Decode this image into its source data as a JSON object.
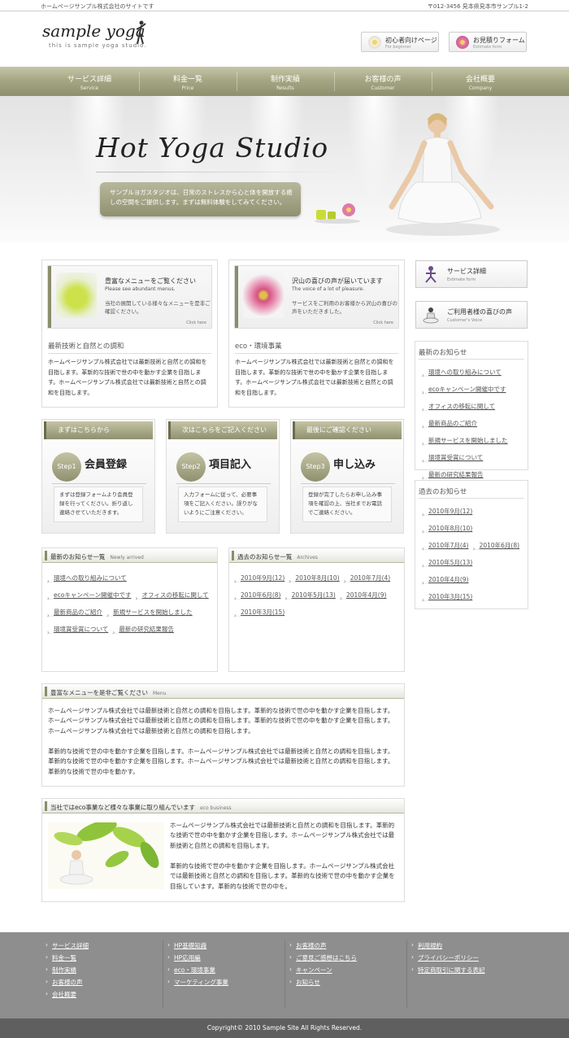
{
  "topbar": {
    "left": "ホームページサンプル株式会社のサイトです",
    "right": "〒012-3456 見本県見本市サンプル1-2"
  },
  "logo": {
    "title": "sample yoga",
    "subtitle": "this is sample yoga studio."
  },
  "header_buttons": [
    {
      "label": "初心者向けページ",
      "sub": "For beginner",
      "icon": "daisy-icon",
      "color": "#e9e4d0"
    },
    {
      "label": "お見積りフォーム",
      "sub": "Estimate form",
      "icon": "flower-icon",
      "color": "#d97aa0"
    }
  ],
  "nav": [
    {
      "label": "サービス詳細",
      "sub": "Service"
    },
    {
      "label": "料金一覧",
      "sub": "Price"
    },
    {
      "label": "制作実績",
      "sub": "Results"
    },
    {
      "label": "お客様の声",
      "sub": "Customer"
    },
    {
      "label": "会社概要",
      "sub": "Company"
    }
  ],
  "hero": {
    "title": "Hot Yoga Studio",
    "text": "サンプルヨガスタジオは、日常のストレスから心と体を開放する癒しの空間をご提供します。まずは無料体験をしてみてください。"
  },
  "features": [
    {
      "title": "豊富なメニューをご覧ください",
      "sub": "Please see abundant menus.",
      "text": "当社の展開している様々なメニューを是非ご確認ください。",
      "more": "Click here",
      "heading": "最新技術と自然との調和",
      "body": "ホームページサンプル株式会社では最新技術と自然との調和を目指します。革新的な技術で世の中を動かす企業を目指します。ホームページサンプル株式会社では最新技術と自然との調和を目指します。"
    },
    {
      "title": "沢山の喜びの声が届いています",
      "sub": "The voice of a lot of pleasure.",
      "text": "サービスをご利用のお客様から沢山の喜びの声をいただきました。",
      "more": "Click here",
      "heading": "eco・環境事業",
      "body": "ホームページサンプル株式会社では最新技術と自然との調和を目指します。革新的な技術で世の中を動かす企業を目指します。ホームページサンプル株式会社では最新技術と自然との調和を目指します。"
    }
  ],
  "steps": [
    {
      "head": "まずはこちらから",
      "step": "Step1",
      "title": "会員登録",
      "desc": "まずは登録フォームより会員登録を行ってください。折り返し連絡させていただきます。"
    },
    {
      "head": "次はこちらをご記入ください",
      "step": "Step2",
      "title": "項目記入",
      "desc": "入力フォームに従って、必要事項をご記入ください。誤りがないようにご注意ください。"
    },
    {
      "head": "最後にご確認ください",
      "step": "Step3",
      "title": "申し込み",
      "desc": "登録が完了したらお申し込み事項を確認の上、当社までお電話でご連絡ください。"
    }
  ],
  "news": {
    "title": "最新のお知らせ一覧",
    "sub": "Newly arrived",
    "items": [
      "環境への取り組みについて",
      "ecoキャンペーン開催中です",
      "オフィスの移転に関して",
      "最新商品のご紹介",
      "新規サービスを開始しました",
      "環境賞受賞について",
      "最新の研究結果報告"
    ]
  },
  "archives": {
    "title": "過去のお知らせ一覧",
    "sub": "Archives",
    "items": [
      "2010年9月(12)",
      "2010年8月(10)",
      "2010年7月(4)",
      "2010年6月(8)",
      "2010年5月(13)",
      "2010年4月(9)",
      "2010年3月(15)"
    ]
  },
  "menu_section": {
    "title": "豊富なメニューを是非ご覧ください",
    "sub": "Menu",
    "p1": "ホームページサンプル株式会社では最新技術と自然との調和を目指します。革新的な技術で世の中を動かす企業を目指します。ホームページサンプル株式会社では最新技術と自然との調和を目指します。革新的な技術で世の中を動かす企業を目指します。ホームページサンプル株式会社では最新技術と自然との調和を目指します。",
    "p2": "革新的な技術で世の中を動かす企業を目指します。ホームページサンプル株式会社では最新技術と自然との調和を目指します。革新的な技術で世の中を動かす企業を目指します。ホームページサンプル株式会社では最新技術と自然との調和を目指します。革新的な技術で世の中を動かす。"
  },
  "eco_section": {
    "title": "当社ではeco事業など様々な事業に取り組んでいます",
    "sub": "eco business",
    "p1": "ホームページサンプル株式会社では最新技術と自然との調和を目指します。革新的な技術で世の中を動かす企業を目指します。ホームページサンプル株式会社では最新技術と自然との調和を目指します。",
    "p2": "革新的な技術で世の中を動かす企業を目指します。ホームページサンプル株式会社では最新技術と自然との調和を目指します。革新的な技術で世の中を動かす企業を目指しています。革新的な技術で世の中を。"
  },
  "sidebar": {
    "buttons": [
      {
        "label": "サービス詳細",
        "sub": "Estimate form"
      },
      {
        "label": "ご利用者様の喜びの声",
        "sub": "Customer's Voice"
      }
    ],
    "news_title": "最新のお知らせ",
    "news": [
      "環境への取り組みについて",
      "ecoキャンペーン開催中です",
      "オフィスの移転に関して",
      "最新商品のご紹介",
      "新規サービスを開始しました",
      "環境賞受賞について",
      "最新の研究結果報告"
    ],
    "archive_title": "過去のお知らせ",
    "archives": [
      "2010年9月(12)",
      "2010年8月(10)",
      "2010年7月(4)",
      "2010年6月(8)",
      "2010年5月(13)",
      "2010年4月(9)",
      "2010年3月(15)"
    ]
  },
  "footer": {
    "cols": [
      [
        "サービス詳細",
        "料金一覧",
        "制作実績",
        "お客様の声",
        "会社概要"
      ],
      [
        "HP基礎知識",
        "HP応用編",
        "eco・環境事業",
        "マーケティング事業"
      ],
      [
        "お客様の声",
        "ご意見ご感想はこちら",
        "キャンペーン",
        "お知らせ"
      ],
      [
        "利用規約",
        "プライバシーポリシー",
        "特定商取引に関する表記"
      ]
    ],
    "copyright": "Copyright© 2010 Sample Site All Rights Reserved."
  }
}
